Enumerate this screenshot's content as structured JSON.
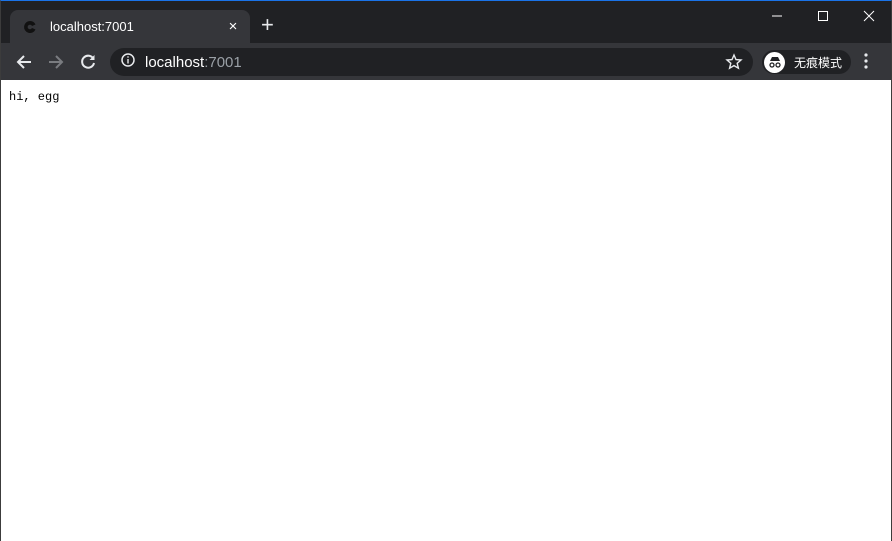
{
  "tab": {
    "title": "localhost:7001",
    "close_label": "×"
  },
  "new_tab_label": "+",
  "omnibox": {
    "host": "localhost",
    "port": ":7001"
  },
  "incognito": {
    "label": "无痕模式"
  },
  "page": {
    "text": "hi, egg"
  },
  "colors": {
    "titlebar": "#202124",
    "toolbar": "#35363a",
    "accent": "#1a73e8"
  }
}
